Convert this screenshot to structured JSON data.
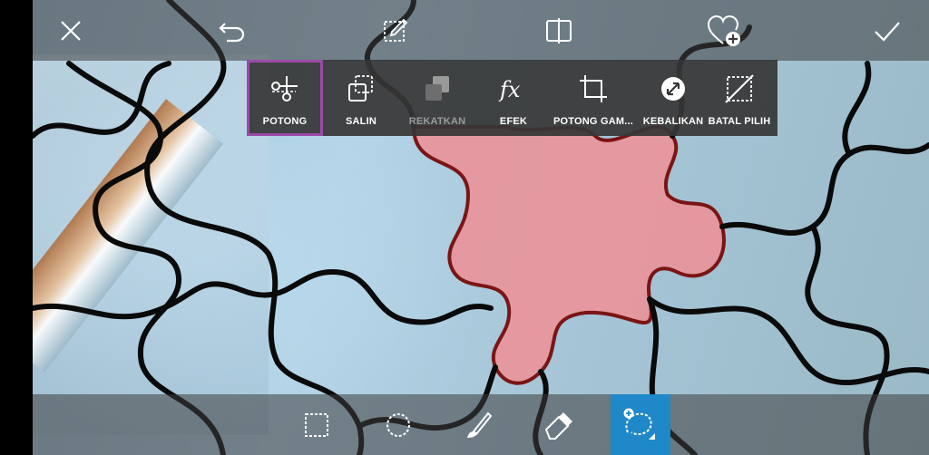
{
  "app": {
    "accent_color": "#9b4aa8",
    "active_tool_color": "#1e88c8"
  },
  "top_bar": {
    "buttons": [
      {
        "name": "close",
        "icon": "close-icon"
      },
      {
        "name": "undo",
        "icon": "undo-icon"
      },
      {
        "name": "edit",
        "icon": "edit-icon"
      },
      {
        "name": "compare",
        "icon": "compare-icon"
      },
      {
        "name": "favorite-add",
        "icon": "heart-plus-icon"
      },
      {
        "name": "apply",
        "icon": "check-icon"
      }
    ]
  },
  "selection_menu": {
    "items": [
      {
        "label": "POTONG",
        "icon": "scissors-icon",
        "selected": true,
        "enabled": true
      },
      {
        "label": "SALIN",
        "icon": "copy-icon",
        "selected": false,
        "enabled": true
      },
      {
        "label": "REKATKAN",
        "icon": "paste-icon",
        "selected": false,
        "enabled": false
      },
      {
        "label": "EFEK",
        "icon": "fx-icon",
        "selected": false,
        "enabled": true
      },
      {
        "label": "POTONG GAM...",
        "icon": "crop-icon",
        "selected": false,
        "enabled": true
      },
      {
        "label": "KEBALIKAN",
        "icon": "invert-icon",
        "selected": false,
        "enabled": true
      },
      {
        "label": "BATAL PILIH",
        "icon": "deselect-icon",
        "selected": false,
        "enabled": true
      }
    ]
  },
  "bottom_tools": [
    {
      "name": "rectangle-select",
      "icon": "rectangle-select-icon",
      "active": false
    },
    {
      "name": "ellipse-select",
      "icon": "ellipse-select-icon",
      "active": false
    },
    {
      "name": "brush-select",
      "icon": "brush-icon",
      "active": false
    },
    {
      "name": "eraser",
      "icon": "eraser-icon",
      "active": false
    },
    {
      "name": "lasso-add",
      "icon": "lasso-add-icon",
      "active": true
    }
  ]
}
